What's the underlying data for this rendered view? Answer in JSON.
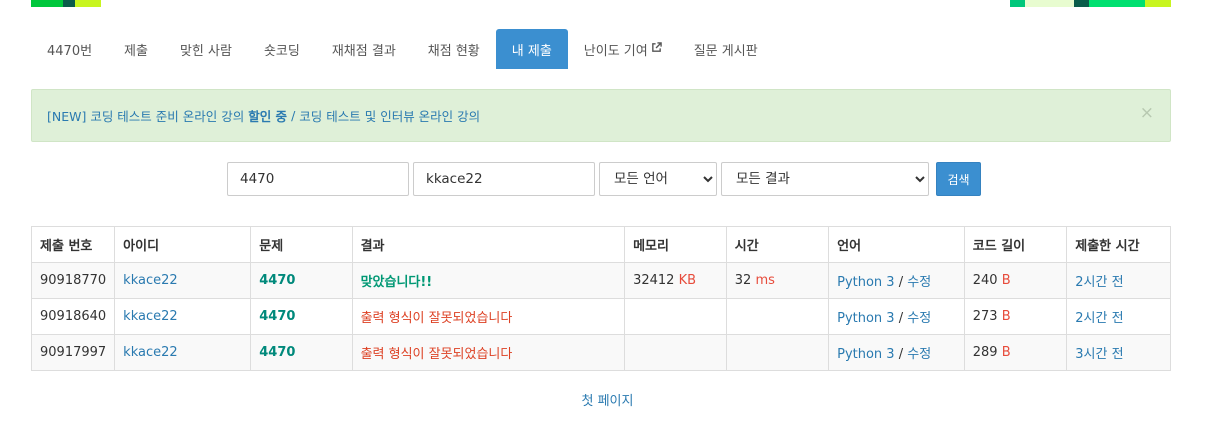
{
  "tabs": [
    {
      "label": "4470번",
      "active": false
    },
    {
      "label": "제출",
      "active": false
    },
    {
      "label": "맞힌 사람",
      "active": false
    },
    {
      "label": "숏코딩",
      "active": false
    },
    {
      "label": "재채점 결과",
      "active": false
    },
    {
      "label": "채점 현황",
      "active": false
    },
    {
      "label": "내 제출",
      "active": true
    },
    {
      "label": "난이도 기여",
      "active": false
    },
    {
      "label": "질문 게시판",
      "active": false
    }
  ],
  "alert": {
    "prefix": "[NEW] 코딩 테스트 준비 온라인 강의 ",
    "bold": "할인 중",
    "separator": "/",
    "second": "코딩 테스트 및 인터뷰 온라인 강의",
    "close": "×"
  },
  "search": {
    "problem_value": "4470",
    "user_value": "kkace22",
    "language_selected": "모든 언어",
    "result_selected": "모든 결과",
    "button_label": "검색"
  },
  "table": {
    "headers": [
      "제출 번호",
      "아이디",
      "문제",
      "결과",
      "메모리",
      "시간",
      "언어",
      "코드 길이",
      "제출한 시간"
    ],
    "rows": [
      {
        "id": "90918770",
        "user": "kkace22",
        "problem": "4470",
        "result": "맞았습니다!!",
        "result_type": "ac",
        "memory": "32412",
        "memory_unit": "KB",
        "time": "32",
        "time_unit": "ms",
        "language": "Python 3",
        "lang_sep": "/",
        "edit": "수정",
        "length": "240",
        "length_unit": "B",
        "submitted": "2시간 전"
      },
      {
        "id": "90918640",
        "user": "kkace22",
        "problem": "4470",
        "result": "출력 형식이 잘못되었습니다",
        "result_type": "pe",
        "memory": "",
        "memory_unit": "",
        "time": "",
        "time_unit": "",
        "language": "Python 3",
        "lang_sep": "/",
        "edit": "수정",
        "length": "273",
        "length_unit": "B",
        "submitted": "2시간 전"
      },
      {
        "id": "90917997",
        "user": "kkace22",
        "problem": "4470",
        "result": "출력 형식이 잘못되었습니다",
        "result_type": "pe",
        "memory": "",
        "memory_unit": "",
        "time": "",
        "time_unit": "",
        "language": "Python 3",
        "lang_sep": "/",
        "edit": "수정",
        "length": "289",
        "length_unit": "B",
        "submitted": "3시간 전"
      }
    ]
  },
  "pager": {
    "first_page": "첫 페이지"
  },
  "colors": {
    "accent": "#3b8fd0",
    "link": "#2a7ab0",
    "accepted": "#009874",
    "presentation_error": "#dd4124",
    "unit": "#e74c3c",
    "alert_bg": "#dff0d8",
    "deco_left": [
      "#00c73c",
      "#0a5c4a",
      "#c8f51f"
    ],
    "deco_right": [
      "#00c77b",
      "#e8fcd0",
      "#e8fcd0",
      "#0a5c4a",
      "#00e070",
      "#c8f51f"
    ]
  }
}
